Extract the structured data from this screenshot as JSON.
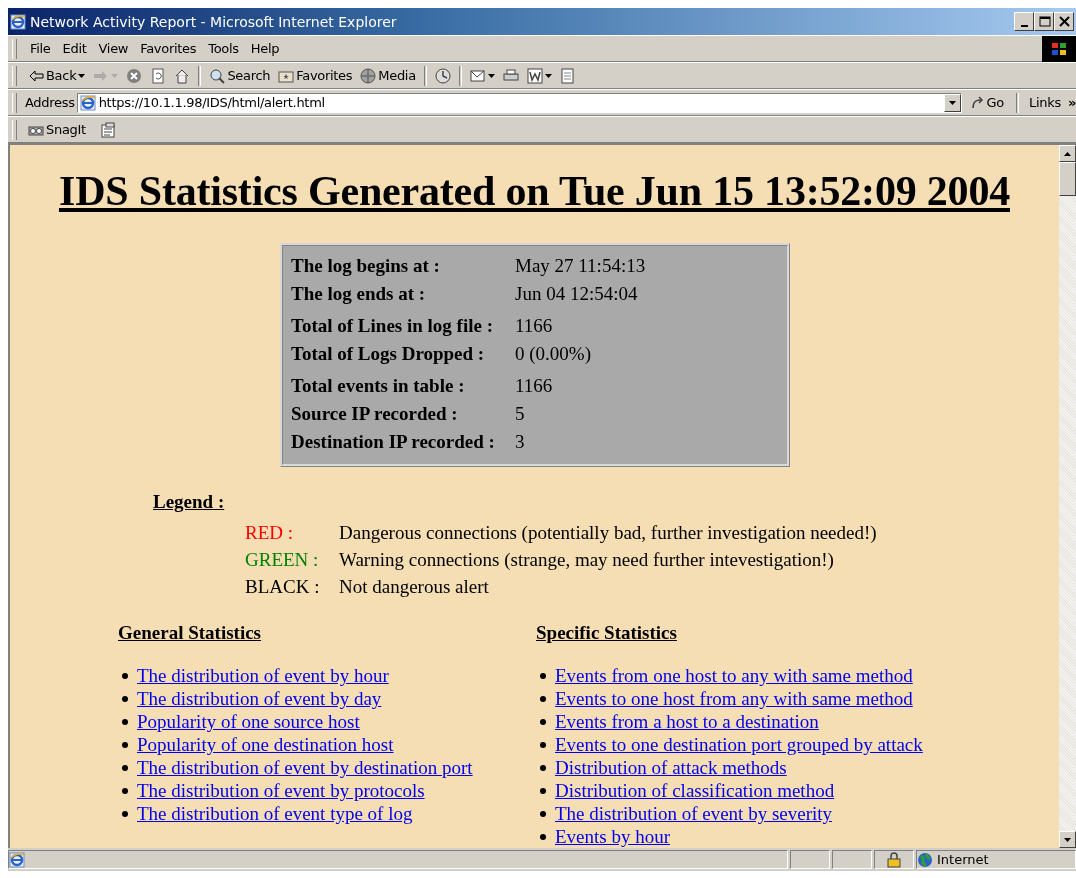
{
  "window": {
    "title": "Network Activity Report - Microsoft Internet Explorer"
  },
  "menu": [
    "File",
    "Edit",
    "View",
    "Favorites",
    "Tools",
    "Help"
  ],
  "toolbar": [
    {
      "kind": "back",
      "label": "Back",
      "disabled": false
    },
    {
      "kind": "forward",
      "disabled": true
    },
    {
      "kind": "stop",
      "disabled": false
    },
    {
      "kind": "refresh",
      "disabled": false
    },
    {
      "kind": "home",
      "disabled": false
    },
    {
      "kind": "search",
      "label": "Search",
      "disabled": false
    },
    {
      "kind": "favorites",
      "label": "Favorites",
      "disabled": false
    },
    {
      "kind": "media",
      "label": "Media",
      "disabled": false
    },
    {
      "kind": "history",
      "disabled": false
    },
    {
      "kind": "mail",
      "disabled": false
    },
    {
      "kind": "print",
      "disabled": false
    },
    {
      "kind": "edit",
      "disabled": false
    },
    {
      "kind": "discuss",
      "disabled": false
    }
  ],
  "address_bar": {
    "label": "Address",
    "url": "https://10.1.1.98/IDS/html/alert.html",
    "go": "Go",
    "links": "Links",
    "more": "»"
  },
  "links_bar": {
    "snagit": "SnagIt"
  },
  "page": {
    "heading": "IDS Statistics Generated on Tue Jun 15 13:52:09 2004",
    "summary": [
      {
        "label": "The log begins at :",
        "value": "May 27 11:54:13"
      },
      {
        "label": "The log ends at :",
        "value": "Jun 04 12:54:04"
      },
      {
        "label": "Total of Lines in log file :",
        "value": "1166"
      },
      {
        "label": "Total of Logs Dropped :",
        "value": "0 (0.00%)"
      },
      {
        "label": "Total events in table :",
        "value": "1166"
      },
      {
        "label": "Source IP recorded :",
        "value": "5"
      },
      {
        "label": "Destination IP recorded :",
        "value": "3"
      }
    ],
    "legend": {
      "title": "Legend :",
      "items": [
        {
          "label": "RED :",
          "description": "Dangerous connections (potentially bad, further investigation needed!)",
          "color": "#ff0000"
        },
        {
          "label": "GREEN :",
          "description": "Warning connections (strange, may need further intevestigation!)",
          "color": "#008000"
        },
        {
          "label": "BLACK :",
          "description": "Not dangerous alert",
          "color": "#000000"
        }
      ]
    },
    "general": {
      "title": "General Statistics",
      "links": [
        "The distribution of event by hour",
        "The distribution of event by day",
        "Popularity of one source host",
        "Popularity of one destination host",
        "The distribution of event by destination port",
        "The distribution of event by protocols",
        "The distribution of event type of log"
      ]
    },
    "specific": {
      "title": "Specific Statistics",
      "links": [
        "Events from one host to any with same method",
        "Events to one host from any with same method",
        "Events from a host to a destination",
        "Events to one destination port grouped by attack",
        "Distribution of attack methods",
        "Distribution of classification method",
        "The distribution of event by severity",
        "Events by hour"
      ]
    }
  },
  "status_bar": {
    "zone": "Internet"
  }
}
